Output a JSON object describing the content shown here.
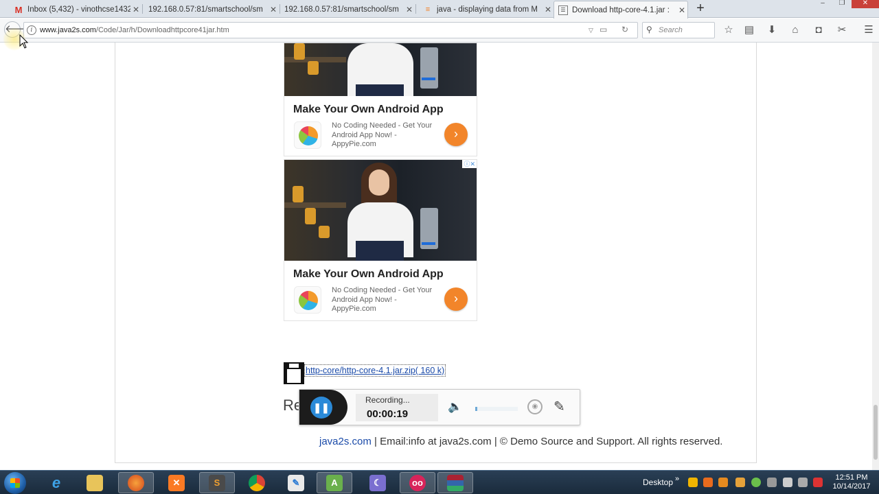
{
  "tabs": [
    {
      "title": "Inbox (5,432) - vinothcse1432",
      "icon": "gmail-icon"
    },
    {
      "title": "192.168.0.57:81/smartschool/sm",
      "icon": "page-icon"
    },
    {
      "title": "192.168.0.57:81/smartschool/sm",
      "icon": "page-icon"
    },
    {
      "title": "java - displaying data from M",
      "icon": "stackoverflow-icon"
    },
    {
      "title": "Download http-core-4.1.jar :",
      "icon": "java2s-icon"
    }
  ],
  "navbar": {
    "url_domain": "www.java2s.com",
    "url_path": "/Code/Jar/h/Downloadhttpcore41jar.htm",
    "search_placeholder": "Search"
  },
  "ads": [
    {
      "title": "Make Your Own Android App",
      "desc": "No Coding Needed - Get Your Android App Now! - AppyPie.com"
    },
    {
      "title": "Make Your Own Android App",
      "desc": "No Coding Needed - Get Your Android App Now! - AppyPie.com"
    }
  ],
  "download": {
    "link_text": "http-core/http-core-4.1.jar.zip( 160 k)"
  },
  "partial_heading": "Re",
  "footer": {
    "site_link": "java2s.com",
    "rest": "| Email:info at java2s.com | © Demo Source and Support. All rights reserved."
  },
  "recorder": {
    "status": "Recording...",
    "time": "00:00:19",
    "volume_level": 0.05
  },
  "taskbar": {
    "desktop_label": "Desktop",
    "time": "12:51 PM",
    "date": "10/14/2017",
    "apps": [
      "ie-icon",
      "explorer-icon",
      "firefox-icon",
      "xampp-icon",
      "sublime-icon",
      "chrome-icon",
      "paint-icon",
      "android-icon",
      "eclipse-icon",
      "recorder-icon",
      "winrar-icon"
    ]
  },
  "colors": {
    "accent_orange": "#f2852a",
    "link_blue": "#1a4aa8",
    "record_blue": "#2b8ad8"
  }
}
